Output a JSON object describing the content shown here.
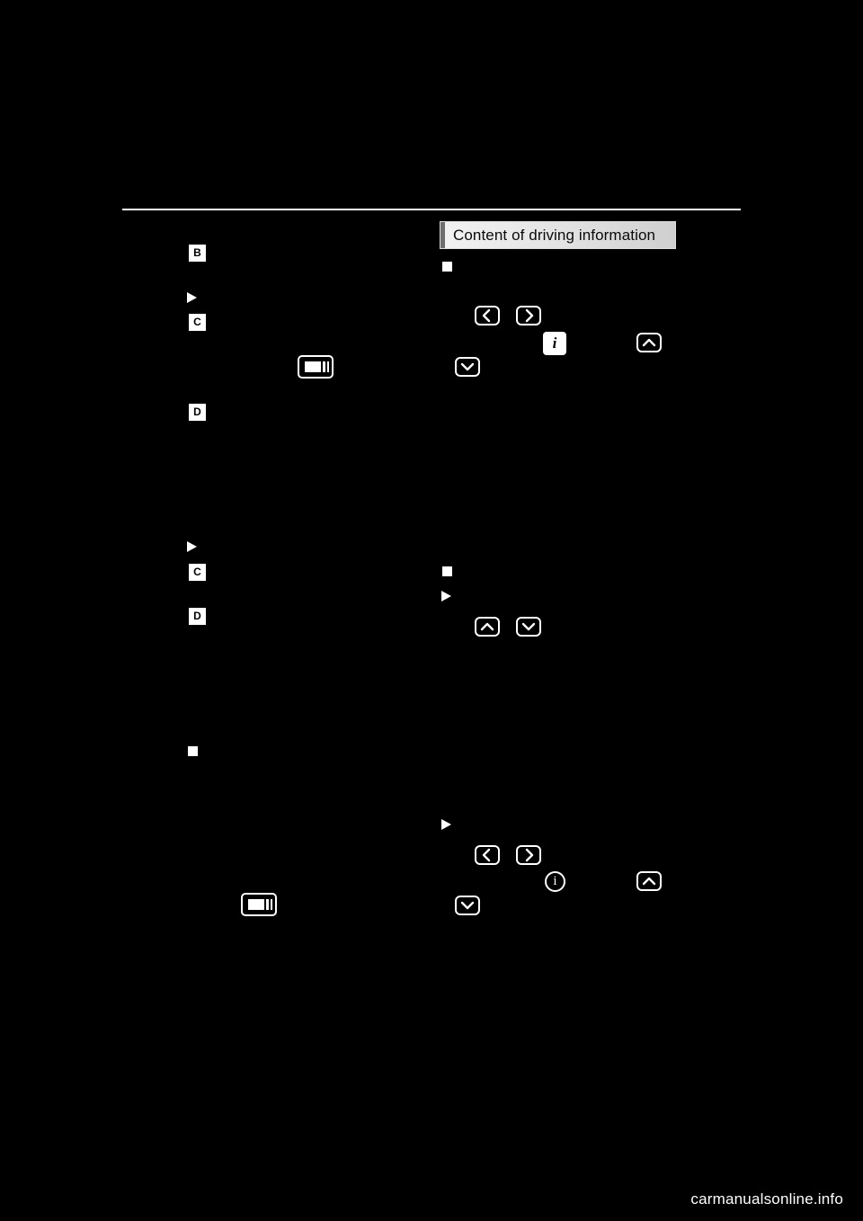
{
  "page": {
    "background_color": "#000000",
    "foreground_color": "#ffffff",
    "footer_watermark": "carmanualsonline.info"
  },
  "header": {
    "rule_visible": true
  },
  "section": {
    "title": "Content of driving information",
    "accent_color": "#6e6e6e",
    "bar_gradient_from": "#f2f2f2",
    "bar_gradient_to": "#cfcfcf"
  },
  "left_column": {
    "callouts": [
      {
        "letter": "B",
        "name": "callout-b-top"
      },
      {
        "letter": "C",
        "name": "callout-c-upper"
      },
      {
        "letter": "D",
        "name": "callout-d-upper"
      },
      {
        "letter": "C",
        "name": "callout-c-lower"
      },
      {
        "letter": "D",
        "name": "callout-d-lower"
      }
    ],
    "triangle_bullets": [
      {
        "name": "triangle-bullet-upper"
      },
      {
        "name": "triangle-bullet-lower"
      }
    ],
    "square_bullets": [
      {
        "name": "square-bullet-left"
      }
    ],
    "icons": [
      {
        "name": "layers-icon-upper",
        "label": "layers-icon"
      },
      {
        "name": "layers-icon-lower",
        "label": "layers-icon"
      }
    ]
  },
  "right_column": {
    "square_bullets": [
      {
        "name": "square-bullet-right-top"
      },
      {
        "name": "square-bullet-right-middle"
      }
    ],
    "triangle_bullets": [
      {
        "name": "triangle-bullet-right-middle"
      },
      {
        "name": "triangle-bullet-right-bottom"
      }
    ],
    "keys_group_1": [
      {
        "name": "left-chevron-key",
        "glyph": "chevron-left-icon"
      },
      {
        "name": "right-chevron-key",
        "glyph": "chevron-right-icon"
      },
      {
        "name": "info-key-filled",
        "glyph": "info-i-icon",
        "label": "i"
      },
      {
        "name": "up-chevron-key",
        "glyph": "chevron-up-icon"
      },
      {
        "name": "down-chevron-key",
        "glyph": "chevron-down-icon"
      }
    ],
    "keys_group_2": [
      {
        "name": "up-chevron-key",
        "glyph": "chevron-up-icon"
      },
      {
        "name": "down-chevron-key",
        "glyph": "chevron-down-icon"
      }
    ],
    "keys_group_3": [
      {
        "name": "left-chevron-key",
        "glyph": "chevron-left-icon"
      },
      {
        "name": "right-chevron-key",
        "glyph": "chevron-right-icon"
      },
      {
        "name": "info-key-circle",
        "glyph": "info-circle-icon",
        "label": "i"
      },
      {
        "name": "up-chevron-key",
        "glyph": "chevron-up-icon"
      },
      {
        "name": "down-chevron-key",
        "glyph": "chevron-down-icon"
      }
    ]
  }
}
